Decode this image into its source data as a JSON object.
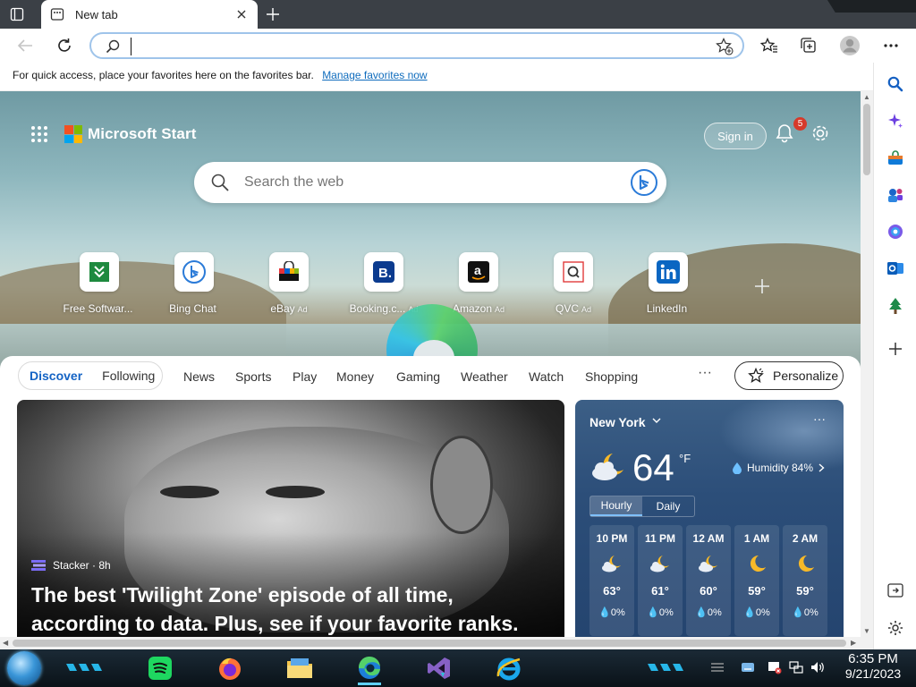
{
  "browser": {
    "tab": {
      "title": "New tab"
    },
    "address_bar": {
      "value": "",
      "placeholder": ""
    },
    "favorites_bar": {
      "message": "For quick access, place your favorites here on the favorites bar.",
      "link": "Manage favorites now"
    }
  },
  "start_page": {
    "brand": "Microsoft Start",
    "sign_in": "Sign in",
    "notification_count": "5",
    "search_placeholder": "Search the web",
    "quick_links": [
      {
        "label": "Free Softwar...",
        "ad": ""
      },
      {
        "label": "Bing Chat",
        "ad": ""
      },
      {
        "label": "eBay",
        "ad": "Ad"
      },
      {
        "label": "Booking.c...",
        "ad": "Ad"
      },
      {
        "label": "Amazon",
        "ad": "Ad"
      },
      {
        "label": "QVC",
        "ad": "Ad"
      },
      {
        "label": "LinkedIn",
        "ad": ""
      }
    ],
    "feed_tabs": {
      "discover": "Discover",
      "following": "Following"
    },
    "nav": [
      "News",
      "Sports",
      "Play",
      "Money",
      "Gaming",
      "Weather",
      "Watch",
      "Shopping"
    ],
    "more": "···",
    "personalize": "Personalize",
    "story": {
      "source": "Stacker · 8h",
      "headline": "The best 'Twilight Zone' episode of all time, according to data. Plus, see if your favorite ranks."
    },
    "weather": {
      "city": "New York",
      "temp": "64",
      "unit": "°F",
      "humidity": "Humidity 84%",
      "tabs": [
        "Hourly",
        "Daily"
      ],
      "hours": [
        {
          "time": "10 PM",
          "temp": "63°",
          "precip": "0%",
          "icon": "partly-cloudy-night-icon"
        },
        {
          "time": "11 PM",
          "temp": "61°",
          "precip": "0%",
          "icon": "partly-cloudy-night-icon"
        },
        {
          "time": "12 AM",
          "temp": "60°",
          "precip": "0%",
          "icon": "partly-cloudy-night-icon"
        },
        {
          "time": "1 AM",
          "temp": "59°",
          "precip": "0%",
          "icon": "clear-night-icon"
        },
        {
          "time": "2 AM",
          "temp": "59°",
          "precip": "0%",
          "icon": "clear-night-icon"
        }
      ]
    }
  },
  "taskbar": {
    "time": "6:35 PM",
    "date": "9/21/2023"
  },
  "colors": {
    "accent": "#1463c4",
    "link": "#0f6cbd",
    "weather_bg": "#2c4e79",
    "taskbar_bg": "#0a1218"
  }
}
